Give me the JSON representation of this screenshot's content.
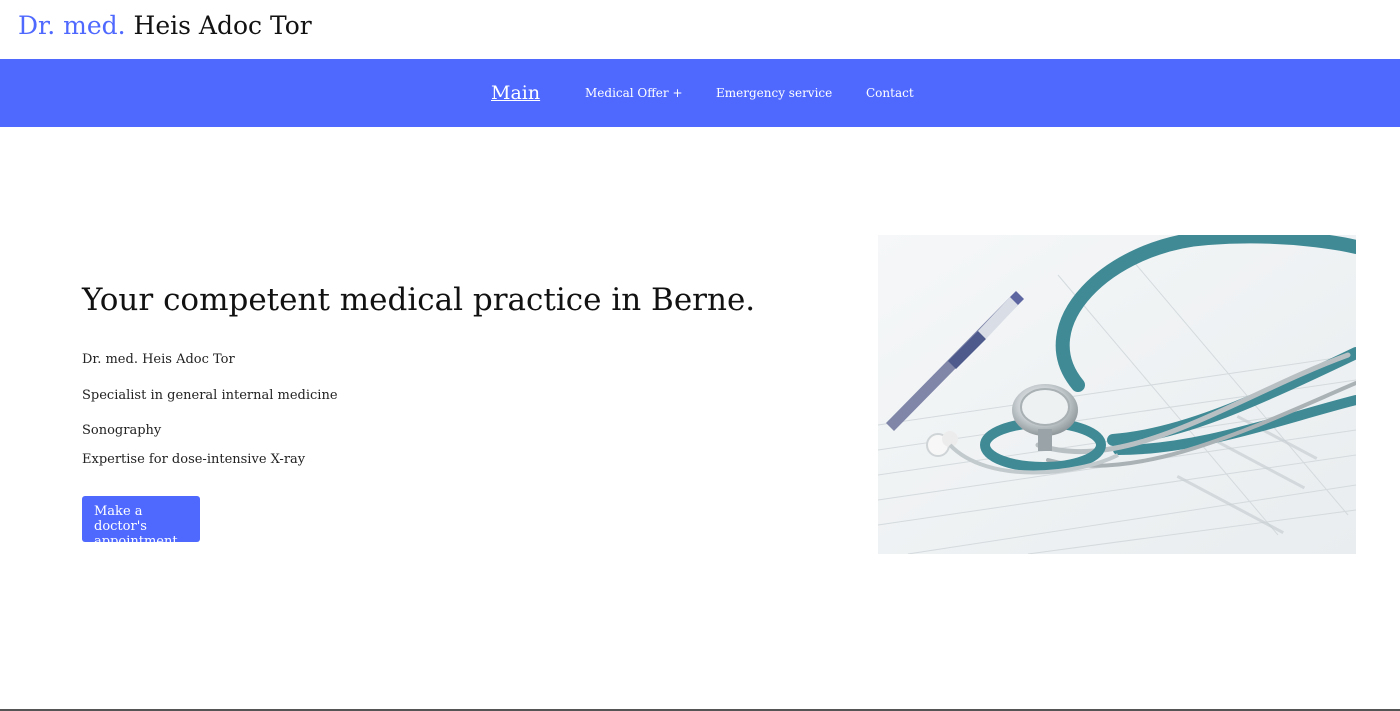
{
  "header": {
    "brand_prefix": "Dr. med.",
    "brand_name": "Heis Adoc Tor"
  },
  "nav": {
    "items": [
      {
        "label": "Main"
      },
      {
        "label": "Medical Offer +"
      },
      {
        "label": "Emergency service"
      },
      {
        "label": "Contact"
      }
    ]
  },
  "hero": {
    "title": "Your competent medical practice in Berne.",
    "lines": [
      "Dr. med. Heis Adoc Tor",
      "Specialist in general internal medicine",
      "Sonography",
      "Expertise for dose-intensive X-ray"
    ],
    "cta_label": "Make a doctor's appointment",
    "image_icon": "stethoscope-photo"
  },
  "colors": {
    "accent": "#4f69ff",
    "text": "#222222",
    "background": "#ffffff"
  }
}
